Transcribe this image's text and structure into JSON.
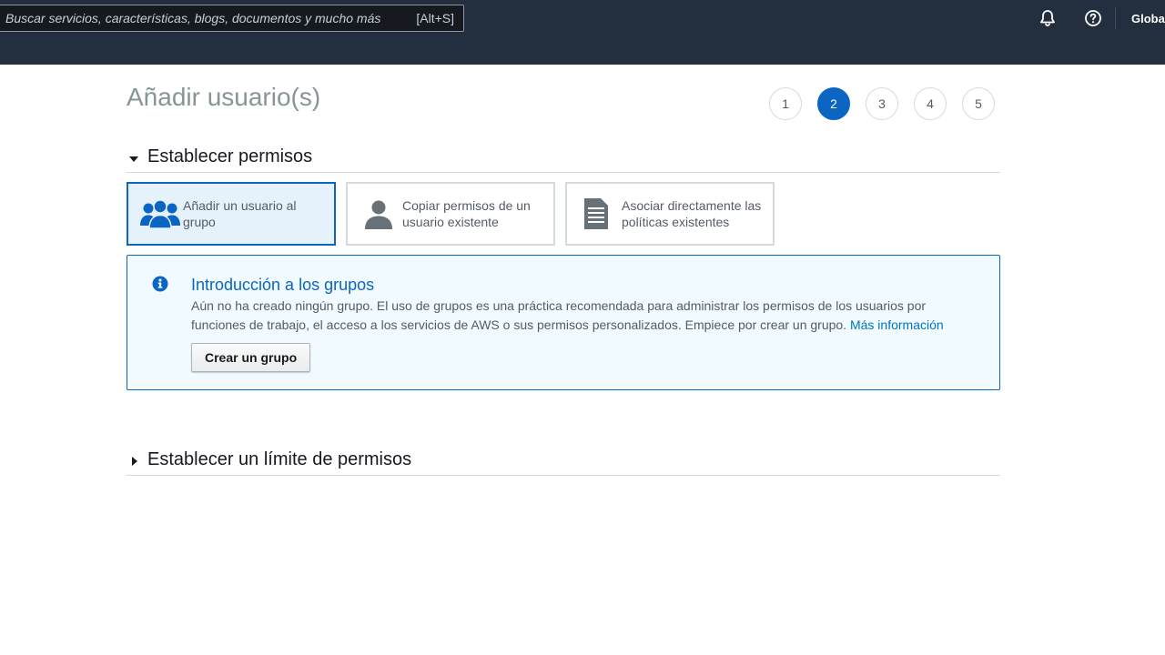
{
  "topbar": {
    "search": {
      "placeholder": "Buscar servicios, características, blogs, documentos y mucho más",
      "shortcut": "[Alt+S]"
    },
    "region": "Global"
  },
  "page": {
    "title": "Añadir usuario(s)"
  },
  "steps": [
    "1",
    "2",
    "3",
    "4",
    "5"
  ],
  "active_step": "2",
  "sections": {
    "permissions": {
      "label": "Establecer permisos",
      "tiles": [
        {
          "label": "Añadir un usuario al grupo",
          "icon": "group-icon"
        },
        {
          "label": "Copiar permisos de un usuario existente",
          "icon": "user-icon"
        },
        {
          "label": "Asociar directamente las políticas existentes",
          "icon": "document-icon"
        }
      ]
    },
    "boundary": {
      "label": "Establecer un límite de permisos"
    }
  },
  "info": {
    "title": "Introducción a los grupos",
    "body": "Aún no ha creado ningún grupo. El uso de grupos es una práctica recomendada para administrar los permisos de los usuarios por funciones de trabajo, el acceso a los servicios de AWS o sus permisos personalizados. Empiece por crear un grupo.",
    "link": "Más información",
    "button": "Crear un grupo"
  },
  "colors": {
    "topbar": "#232f3e",
    "accent": "#0a66c2",
    "info_bg": "#f1faff"
  }
}
